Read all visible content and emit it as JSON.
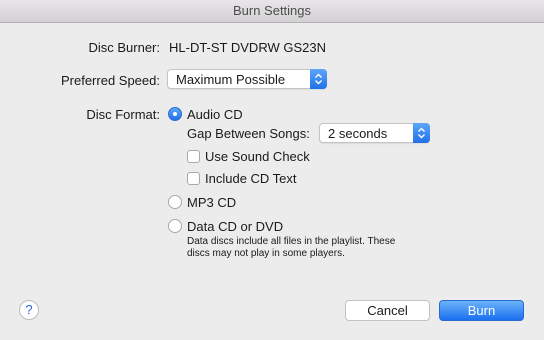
{
  "window": {
    "title": "Burn Settings"
  },
  "disc_burner": {
    "label": "Disc Burner:",
    "value": "HL-DT-ST DVDRW  GS23N"
  },
  "preferred_speed": {
    "label": "Preferred Speed:",
    "selected": "Maximum Possible"
  },
  "disc_format": {
    "label": "Disc Format:",
    "audio_cd": {
      "label": "Audio CD",
      "selected": true,
      "gap_label": "Gap Between Songs:",
      "gap_value": "2 seconds",
      "sound_check_label": "Use Sound Check",
      "sound_check_checked": false,
      "cd_text_label": "Include CD Text",
      "cd_text_checked": false
    },
    "mp3_cd": {
      "label": "MP3 CD",
      "selected": false
    },
    "data_cd": {
      "label": "Data CD or DVD",
      "selected": false,
      "note_line1": "Data discs include all files in the playlist. These",
      "note_line2": "discs may not play in some players."
    }
  },
  "buttons": {
    "help": "?",
    "cancel": "Cancel",
    "burn": "Burn"
  },
  "colors": {
    "accent": "#2170e8",
    "background": "#ececec"
  }
}
